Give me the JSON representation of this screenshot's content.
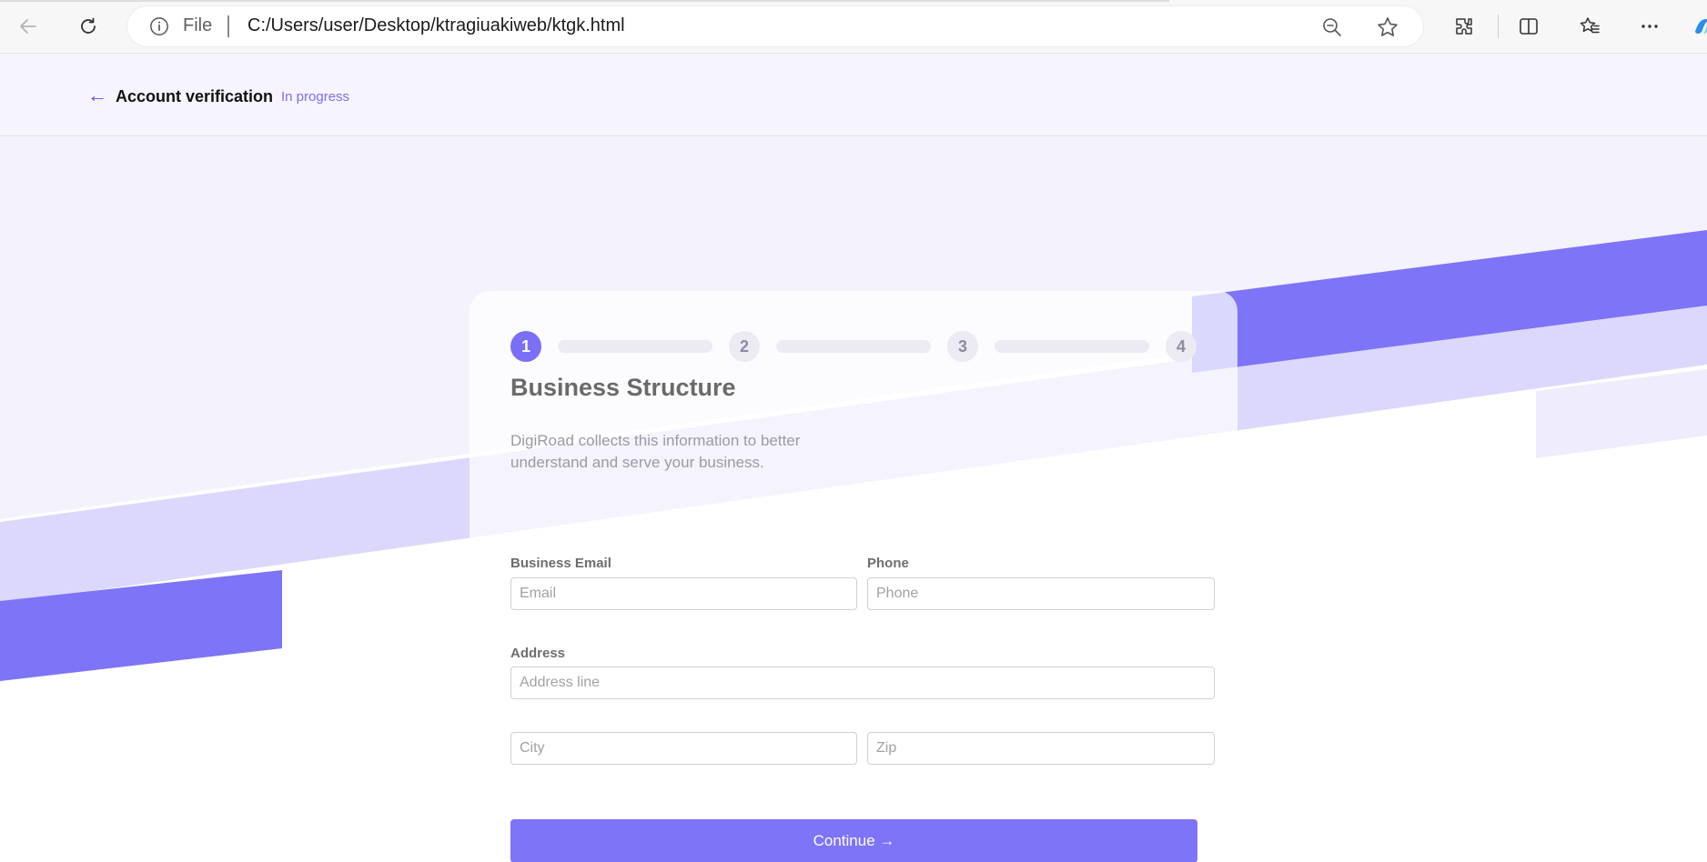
{
  "browser": {
    "scheme_label": "File",
    "url": "C:/Users/user/Desktop/ktragiuakiweb/ktgk.html",
    "icons": [
      "back-arrow-icon",
      "refresh-icon",
      "info-icon",
      "zoom-out-icon",
      "favorite-star-icon",
      "extensions-icon",
      "split-screen-icon",
      "favorites-icon",
      "more-icon",
      "copilot-icon"
    ]
  },
  "header": {
    "title": "Account verification",
    "status": "In progress"
  },
  "stepper": {
    "steps": [
      "1",
      "2",
      "3",
      "4"
    ],
    "active_index": 0
  },
  "form": {
    "title": "Business Structure",
    "description": "DigiRoad collects this information to better understand and serve your business.",
    "email_label": "Business Email",
    "email_placeholder": "Email",
    "phone_label": "Phone",
    "phone_placeholder": "Phone",
    "address_label": "Address",
    "address_placeholder": "Address line",
    "city_placeholder": "City",
    "zip_placeholder": "Zip",
    "continue_label": "Continue →"
  },
  "colors": {
    "accent": "#7a6ff5",
    "band_dark": "#7e74f7",
    "band_light": "#dcd8fb",
    "band_lightest": "#f1eefc",
    "header_bg": "#f6f4fe"
  }
}
